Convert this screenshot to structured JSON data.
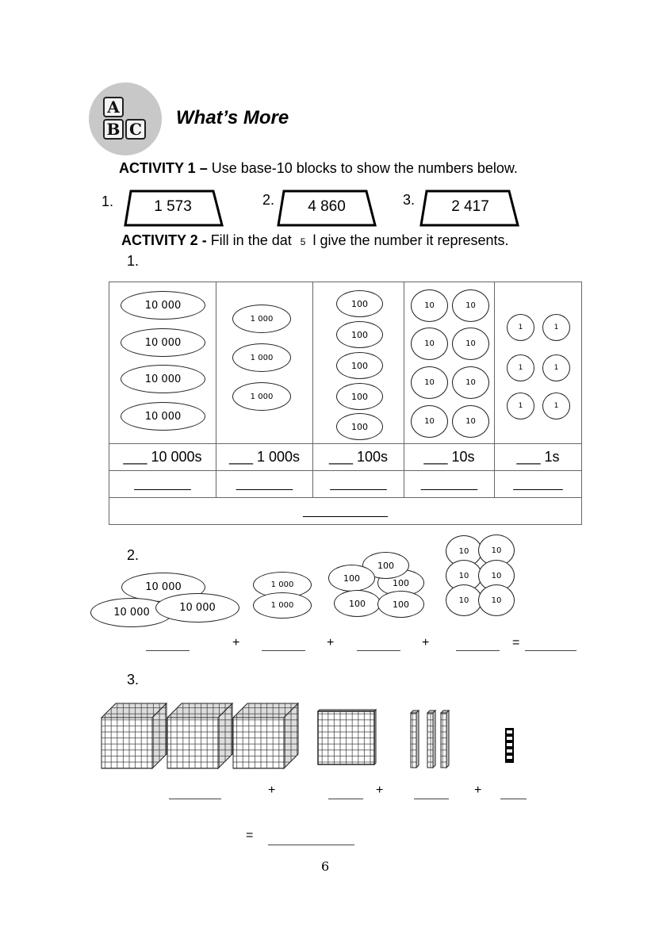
{
  "header": {
    "logo_letters": [
      "A",
      "B",
      "C"
    ],
    "title": "What’s More"
  },
  "activity1": {
    "label": "ACTIVITY 1 –",
    "instruction": " Use base-10 blocks to show the numbers below.",
    "items": [
      {
        "num": "1.",
        "value": "1 573"
      },
      {
        "num": "2.",
        "value": "4 860"
      },
      {
        "num": "3.",
        "value": "2 417"
      }
    ]
  },
  "activity2": {
    "label": "ACTIVITY 2 -",
    "instruction_part1": " Fill in the dat",
    "overlay_digit": "5",
    "instruction_part2": "l give the number it represents.",
    "item1": {
      "num": "1.",
      "columns": [
        {
          "disc_label": "10 000",
          "count": 4,
          "place_label": "___ 10 000s",
          "blank": "________"
        },
        {
          "disc_label": "1 000",
          "count": 3,
          "place_label": "___ 1 000s",
          "blank": "________"
        },
        {
          "disc_label": "100",
          "count": 5,
          "place_label": "___ 100s",
          "blank": "________"
        },
        {
          "disc_label": "10",
          "count": 8,
          "place_label": "___ 10s",
          "blank": "________"
        },
        {
          "disc_label": "1",
          "count": 6,
          "place_label": "___ 1s",
          "blank": "_______"
        }
      ],
      "total_blank": "____________"
    },
    "item2": {
      "num": "2.",
      "groups": [
        {
          "disc_label": "10 000",
          "count": 3
        },
        {
          "disc_label": "1 000",
          "count": 2
        },
        {
          "disc_label": "100",
          "count": 5
        },
        {
          "disc_label": "10",
          "count": 6
        }
      ],
      "equation": {
        "plus": "+",
        "equals": "=",
        "blank": "______"
      }
    },
    "item3": {
      "num": "3.",
      "blocks": [
        {
          "type": "thousand-cube",
          "count": 3
        },
        {
          "type": "hundred-flat",
          "count": 1
        },
        {
          "type": "ten-rod",
          "count": 3
        },
        {
          "type": "ones-unit",
          "count": 5
        }
      ],
      "equation": {
        "plus": "+",
        "equals": "=",
        "blank": "______",
        "total_blank": "___________"
      }
    }
  },
  "footer": {
    "page_number": "6"
  }
}
